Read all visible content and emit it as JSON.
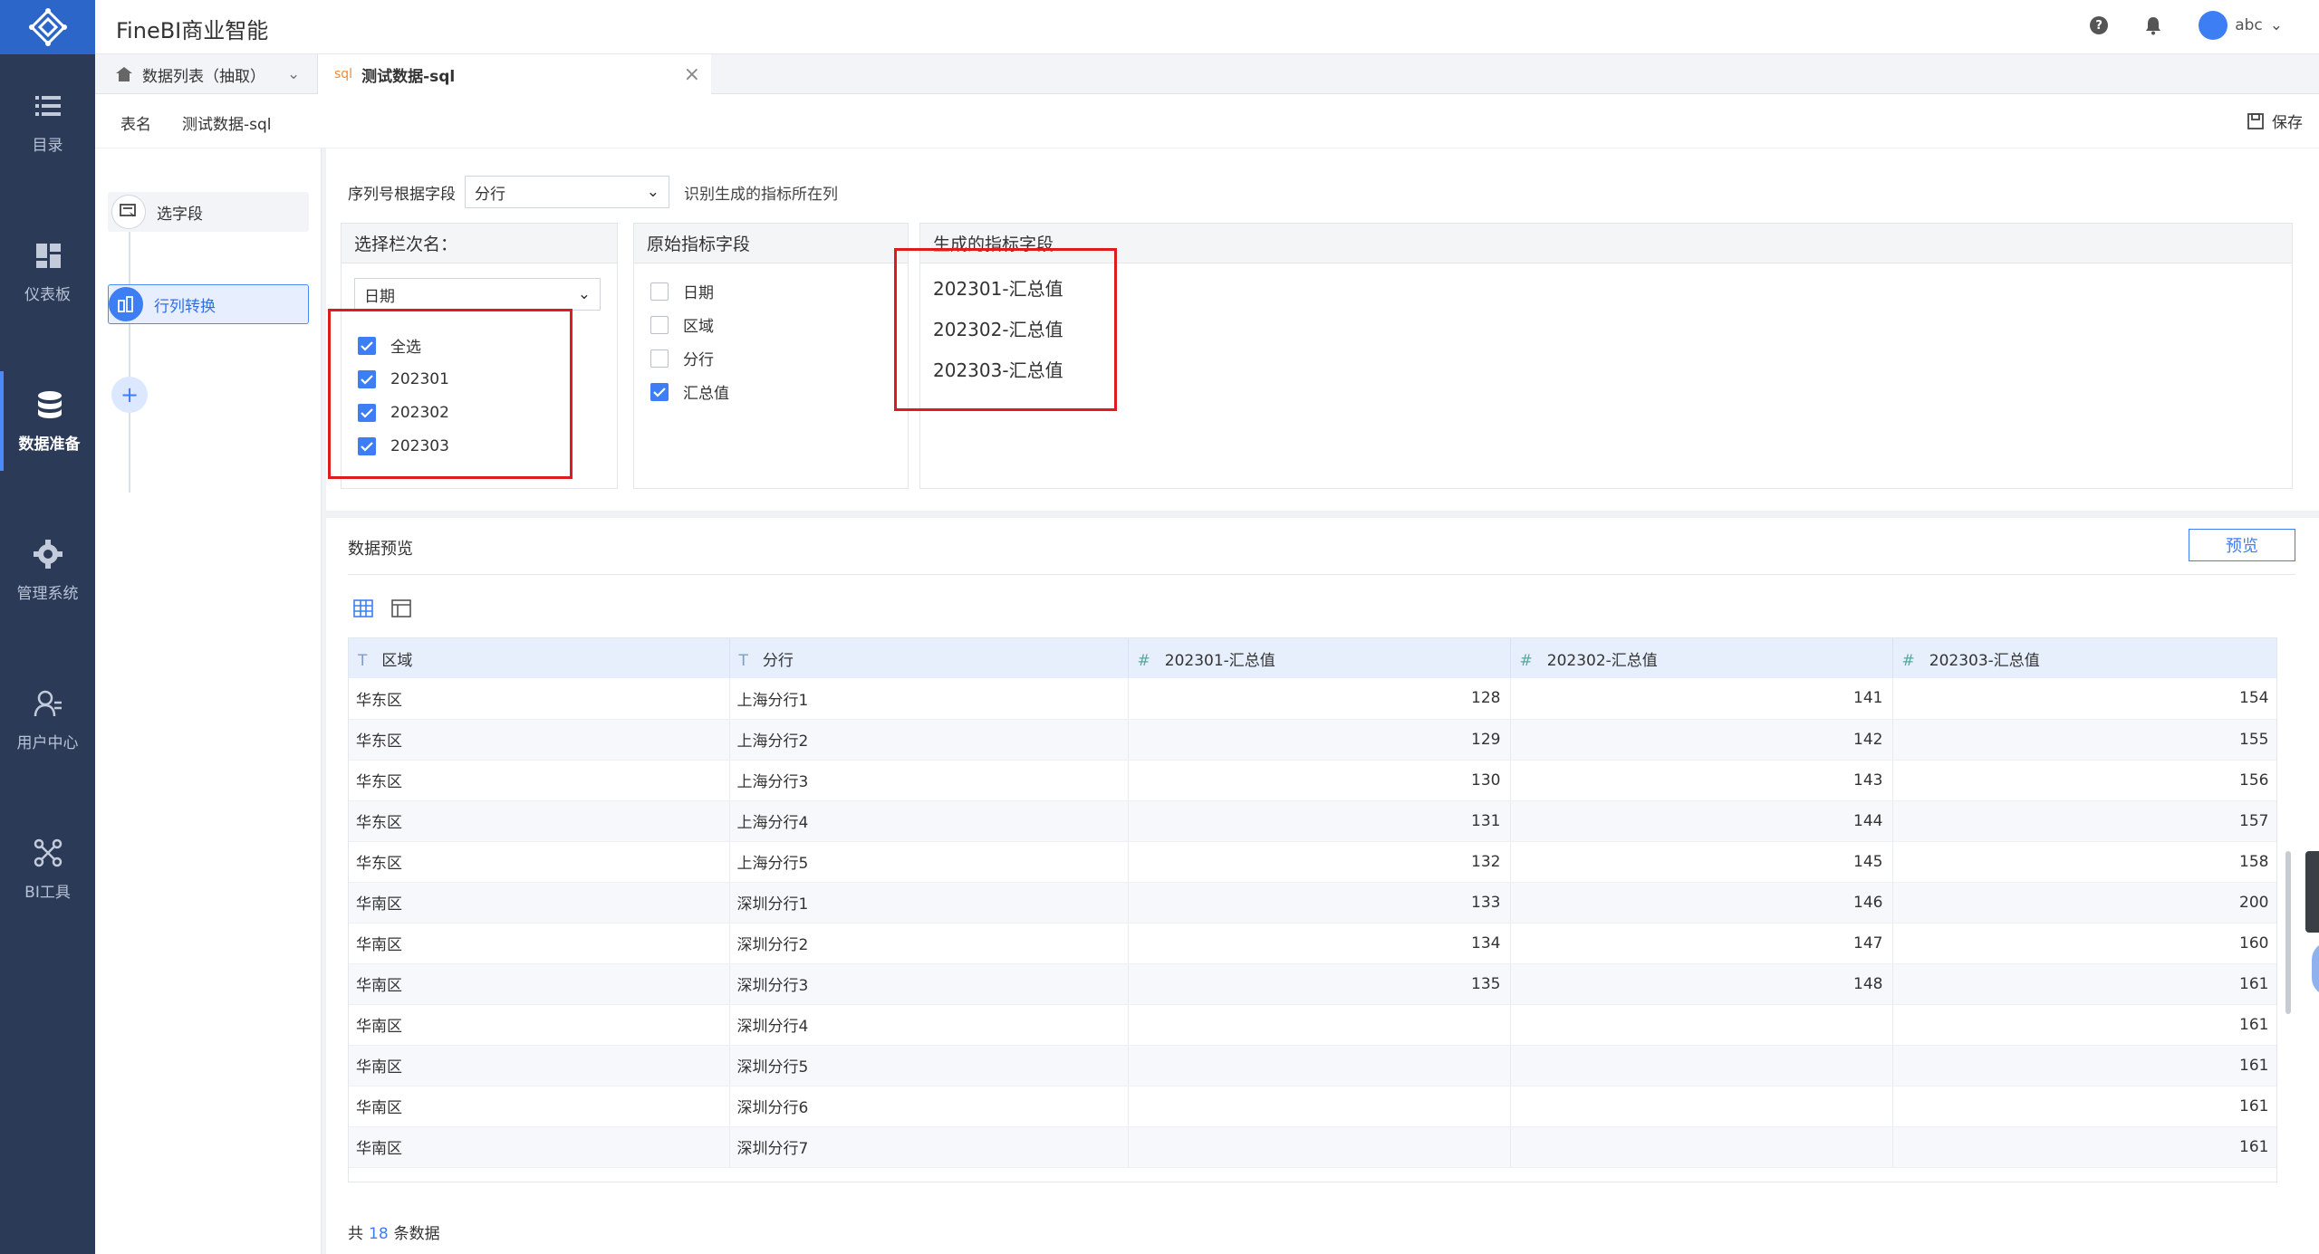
{
  "app": {
    "title": "FineBI商业智能",
    "user": "abc"
  },
  "sidebar": {
    "items": [
      {
        "label": "目录",
        "icon": "list-icon"
      },
      {
        "label": "仪表板",
        "icon": "dashboard-icon"
      },
      {
        "label": "数据准备",
        "icon": "database-icon",
        "active": true
      },
      {
        "label": "管理系统",
        "icon": "gear-icon"
      },
      {
        "label": "用户中心",
        "icon": "user-icon"
      },
      {
        "label": "BI工具",
        "icon": "tools-icon"
      }
    ]
  },
  "tabs": {
    "tab1": {
      "label": "数据列表（抽取）"
    },
    "tab2": {
      "tag": "sql",
      "label": "测试数据-sql"
    }
  },
  "header": {
    "name_label": "表名",
    "name_value": "测试数据-sql",
    "save_label": "保存"
  },
  "steps": {
    "select_fields": "选字段",
    "row_col_transform": "行列转换"
  },
  "config": {
    "sort_label": "序列号根据字段",
    "sort_value": "分行",
    "hint": "识别生成的指标所在列",
    "col_panel": {
      "title": "选择栏次名：",
      "field": "日期",
      "options": [
        {
          "label": "全选",
          "checked": true
        },
        {
          "label": "202301",
          "checked": true
        },
        {
          "label": "202302",
          "checked": true
        },
        {
          "label": "202303",
          "checked": true
        }
      ]
    },
    "orig_panel": {
      "title": "原始指标字段",
      "options": [
        {
          "label": "日期",
          "checked": false
        },
        {
          "label": "区域",
          "checked": false
        },
        {
          "label": "分行",
          "checked": false
        },
        {
          "label": "汇总值",
          "checked": true
        }
      ]
    },
    "gen_panel": {
      "title": "生成的指标字段",
      "items": [
        "202301-汇总值",
        "202302-汇总值",
        "202303-汇总值"
      ]
    }
  },
  "preview": {
    "title": "数据预览",
    "button": "预览",
    "columns": [
      {
        "type": "T",
        "name": "区域"
      },
      {
        "type": "T",
        "name": "分行"
      },
      {
        "type": "#",
        "name": "202301-汇总值"
      },
      {
        "type": "#",
        "name": "202302-汇总值"
      },
      {
        "type": "#",
        "name": "202303-汇总值"
      }
    ],
    "rows": [
      [
        "华东区",
        "上海分行1",
        "128",
        "141",
        "154"
      ],
      [
        "华东区",
        "上海分行2",
        "129",
        "142",
        "155"
      ],
      [
        "华东区",
        "上海分行3",
        "130",
        "143",
        "156"
      ],
      [
        "华东区",
        "上海分行4",
        "131",
        "144",
        "157"
      ],
      [
        "华东区",
        "上海分行5",
        "132",
        "145",
        "158"
      ],
      [
        "华南区",
        "深圳分行1",
        "133",
        "146",
        "200"
      ],
      [
        "华南区",
        "深圳分行2",
        "134",
        "147",
        "160"
      ],
      [
        "华南区",
        "深圳分行3",
        "135",
        "148",
        "161"
      ],
      [
        "华南区",
        "深圳分行4",
        "",
        "",
        "161"
      ],
      [
        "华南区",
        "深圳分行5",
        "",
        "",
        "161"
      ],
      [
        "华南区",
        "深圳分行6",
        "",
        "",
        "161"
      ],
      [
        "华南区",
        "深圳分行7",
        "",
        "",
        "161"
      ]
    ],
    "total_prefix": "共",
    "total_count": "18",
    "total_suffix": "条数据"
  }
}
